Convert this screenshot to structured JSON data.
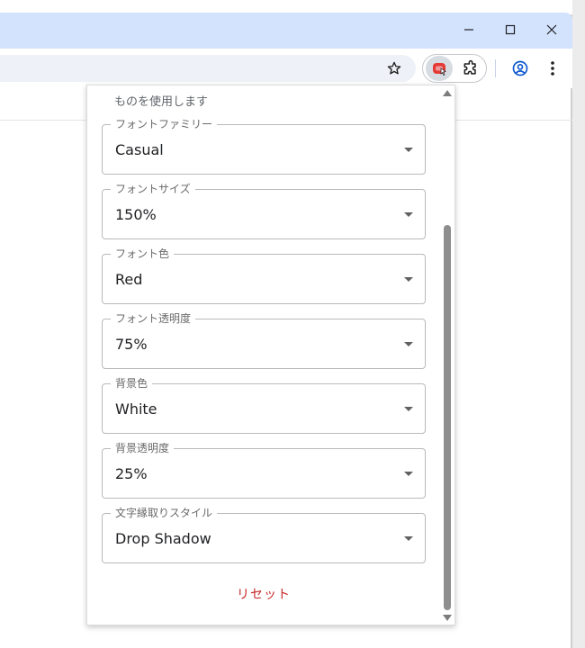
{
  "popup": {
    "description": "ものを使用します",
    "fields": [
      {
        "label": "フォントファミリー",
        "value": "Casual"
      },
      {
        "label": "フォントサイズ",
        "value": "150%"
      },
      {
        "label": "フォント色",
        "value": "Red"
      },
      {
        "label": "フォント透明度",
        "value": "75%"
      },
      {
        "label": "背景色",
        "value": "White"
      },
      {
        "label": "背景透明度",
        "value": "25%"
      },
      {
        "label": "文字縁取りスタイル",
        "value": "Drop Shadow"
      }
    ],
    "reset_label": "リセット"
  },
  "icons": {
    "bookmark": "star-outline-icon",
    "extension_active": "red-extension-icon",
    "extensions_menu": "puzzle-icon",
    "profile": "account-circle-icon",
    "menu": "three-dot-icon"
  },
  "colors": {
    "titlebar": "#d3e3fd",
    "reset_text": "#c62828",
    "extension_red": "#e53935"
  }
}
